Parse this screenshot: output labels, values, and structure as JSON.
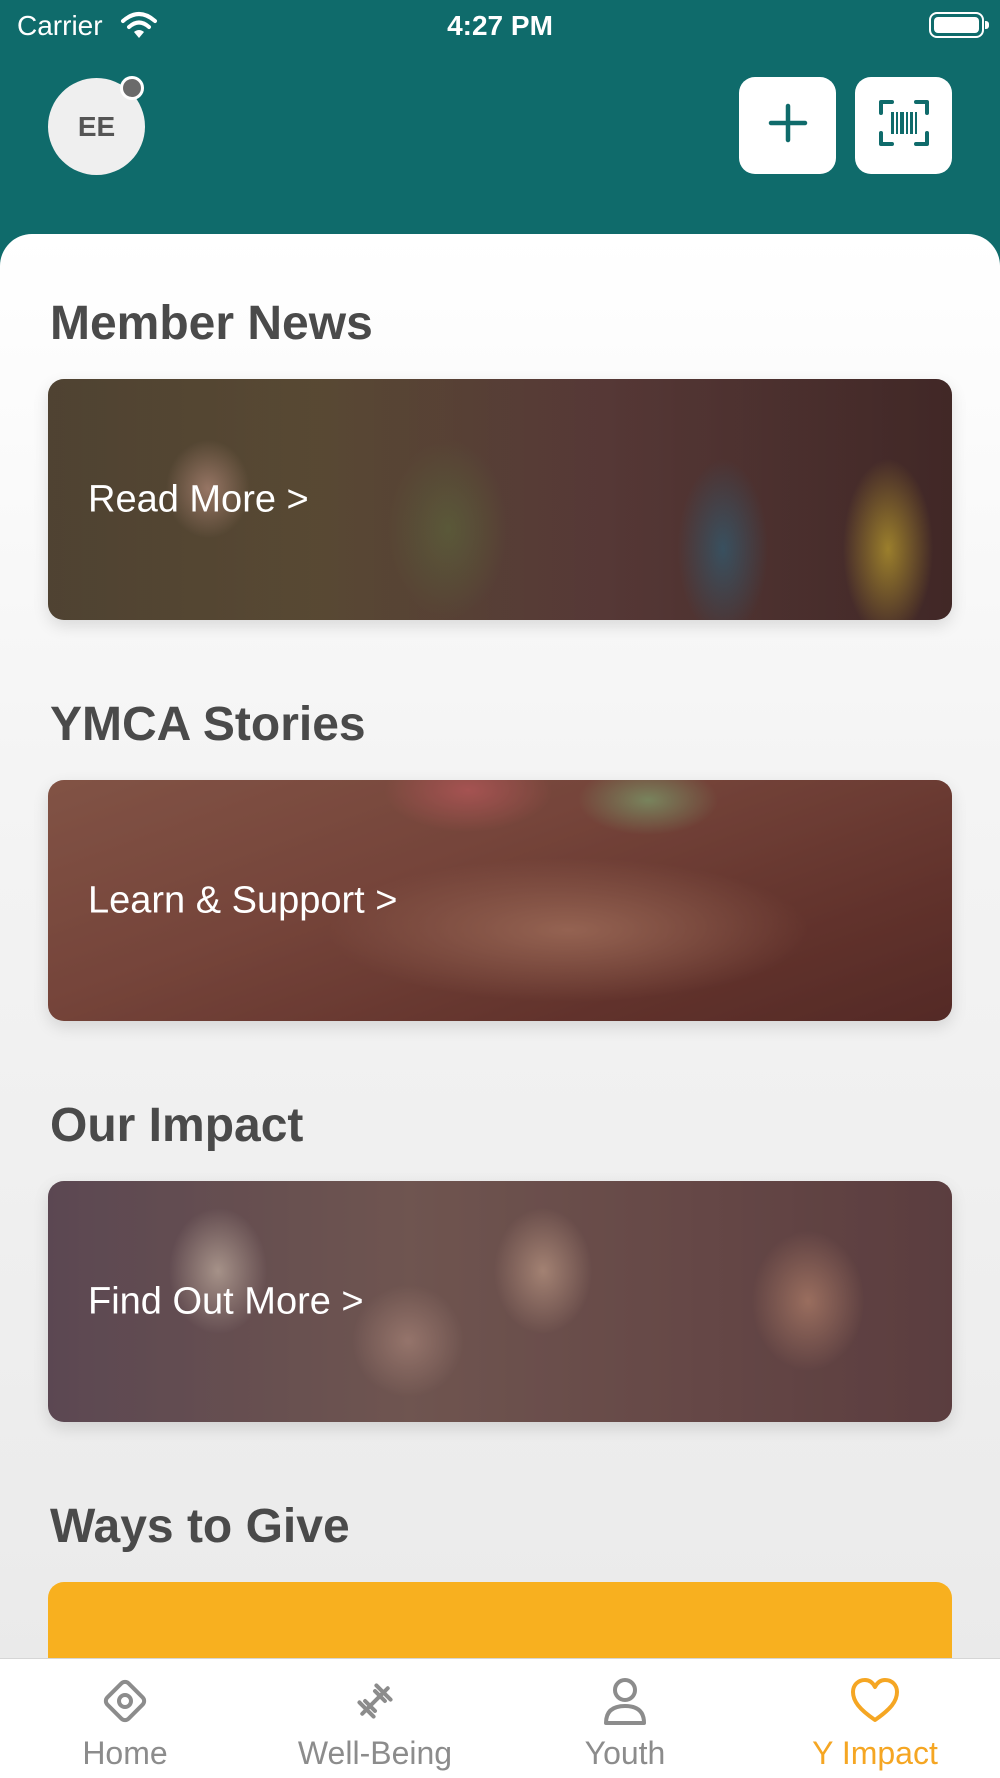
{
  "status_bar": {
    "carrier": "Carrier",
    "time": "4:27 PM"
  },
  "header": {
    "avatar_initials": "EE",
    "add_icon": "plus-icon",
    "scan_icon": "barcode-scan-icon"
  },
  "sections": [
    {
      "title": "Member News",
      "link": "Read More >"
    },
    {
      "title": "YMCA Stories",
      "link": "Learn & Support >"
    },
    {
      "title": "Our Impact",
      "link": "Find Out More >"
    },
    {
      "title": "Ways to Give"
    }
  ],
  "tabs": [
    {
      "label": "Home",
      "icon": "home-diamond-icon"
    },
    {
      "label": "Well-Being",
      "icon": "dumbbell-icon"
    },
    {
      "label": "Youth",
      "icon": "person-icon"
    },
    {
      "label": "Y Impact",
      "icon": "heart-icon",
      "active": true
    }
  ],
  "colors": {
    "brand_teal": "#0f6b6b",
    "accent_orange": "#f5a623",
    "give_card": "#f8b01f"
  }
}
